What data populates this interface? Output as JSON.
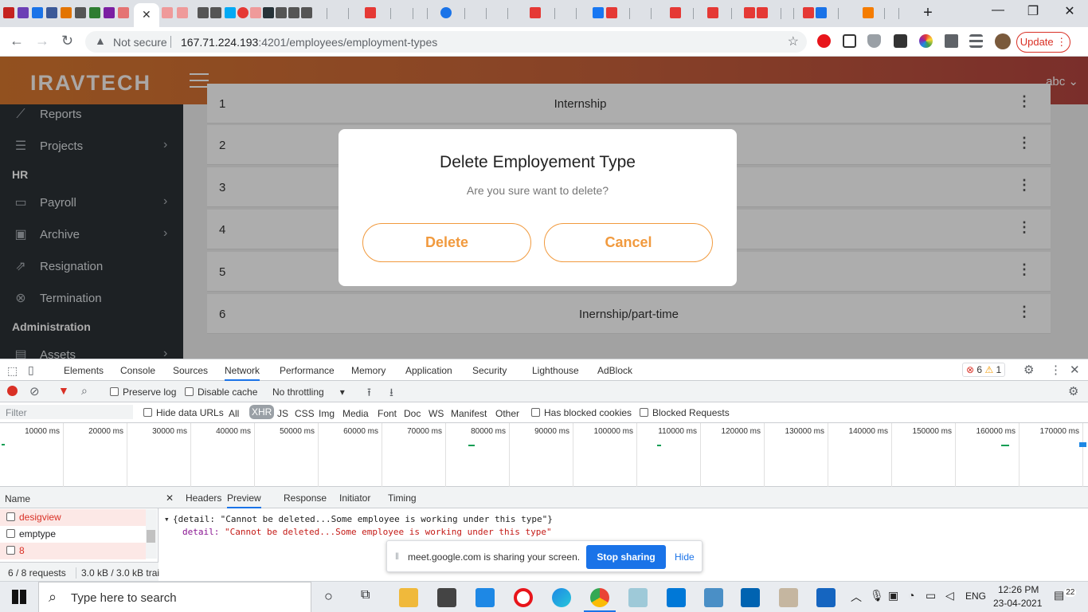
{
  "browser": {
    "tab_close": "✕",
    "new_tab": "+",
    "security_label": "Not secure",
    "url_host": "167.71.224.193",
    "url_port_path": ":4201/employees/employment-types",
    "update_label": "Update",
    "window_controls": [
      "—",
      "❐",
      "✕"
    ]
  },
  "app": {
    "logo": "IRAVTECH",
    "user": "abc",
    "sidebar": {
      "items": [
        {
          "label": "Reports",
          "icon": "chart-line-icon"
        },
        {
          "label": "Projects",
          "icon": "list-icon",
          "chevron": "›"
        },
        {
          "label": "Payroll",
          "icon": "money-icon",
          "chevron": "›"
        },
        {
          "label": "Archive",
          "icon": "archive-icon",
          "chevron": "›"
        },
        {
          "label": "Resignation",
          "icon": "exit-icon"
        },
        {
          "label": "Termination",
          "icon": "cancel-circle-icon"
        },
        {
          "label": "Assets",
          "icon": "box-icon",
          "chevron": "›"
        }
      ],
      "headings": {
        "hr": "HR",
        "admin": "Administration"
      }
    },
    "table": {
      "rows": [
        {
          "num": "1",
          "name": "Internship"
        },
        {
          "num": "2",
          "name": ""
        },
        {
          "num": "3",
          "name": ""
        },
        {
          "num": "4",
          "name": ""
        },
        {
          "num": "5",
          "name": ""
        },
        {
          "num": "6",
          "name": "Inernship/part-time"
        }
      ]
    },
    "modal": {
      "title": "Delete Employement Type",
      "message": "Are you sure want to delete?",
      "delete_label": "Delete",
      "cancel_label": "Cancel"
    }
  },
  "devtools": {
    "tabs": [
      "Elements",
      "Console",
      "Sources",
      "Network",
      "Performance",
      "Memory",
      "Application",
      "Security",
      "Lighthouse",
      "AdBlock"
    ],
    "active_tab": "Network",
    "errors": "6",
    "warnings": "1",
    "preserve_log": "Preserve log",
    "disable_cache": "Disable cache",
    "throttling": "No throttling",
    "filter_placeholder": "Filter",
    "hide_data_urls": "Hide data URLs",
    "types": [
      "All",
      "XHR",
      "JS",
      "CSS",
      "Img",
      "Media",
      "Font",
      "Doc",
      "WS",
      "Manifest",
      "Other"
    ],
    "active_type": "XHR",
    "has_blocked_cookies": "Has blocked cookies",
    "blocked_requests": "Blocked Requests",
    "timeline_ticks": [
      "10000 ms",
      "20000 ms",
      "30000 ms",
      "40000 ms",
      "50000 ms",
      "60000 ms",
      "70000 ms",
      "80000 ms",
      "90000 ms",
      "100000 ms",
      "110000 ms",
      "120000 ms",
      "130000 ms",
      "140000 ms",
      "150000 ms",
      "160000 ms",
      "170000 ms"
    ],
    "name_header": "Name",
    "requests": [
      {
        "name": "desigview",
        "error": true
      },
      {
        "name": "emptype",
        "error": false
      },
      {
        "name": "8",
        "error": true
      }
    ],
    "summary": "6 / 8 requests",
    "transferred": "3.0 kB / 3.0 kB trai",
    "detail_tabs": [
      "Headers",
      "Preview",
      "Response",
      "Initiator",
      "Timing"
    ],
    "active_detail": "Preview",
    "close_x": "✕",
    "preview_line1": "{detail: \"Cannot be deleted...Some employee is working under this type\"}",
    "preview_key": "detail:",
    "preview_value": "\"Cannot be deleted...Some employee is working under this type\""
  },
  "share_bar": {
    "message": "meet.google.com is sharing your screen.",
    "stop": "Stop sharing",
    "hide": "Hide"
  },
  "taskbar": {
    "search_placeholder": "Type here to search",
    "language": "ENG",
    "time": "12:26 PM",
    "date": "23-04-2021",
    "notifications": "22"
  },
  "colors": {
    "accent": "#f19a3e",
    "header_start": "#d8782f",
    "header_end": "#b44540",
    "sidebar": "#2c3136",
    "chrome_blue": "#1a73e8"
  }
}
